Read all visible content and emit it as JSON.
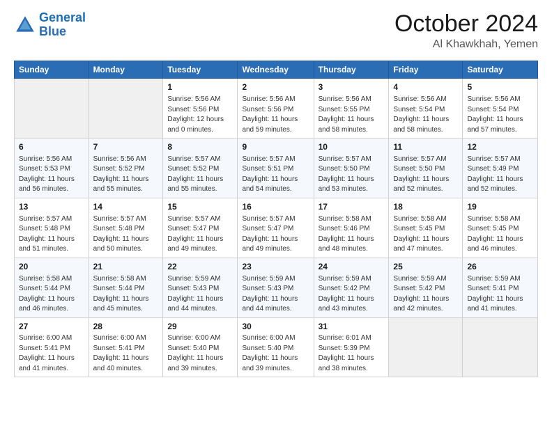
{
  "logo": {
    "line1": "General",
    "line2": "Blue"
  },
  "title": "October 2024",
  "subtitle": "Al Khawkhah, Yemen",
  "weekdays": [
    "Sunday",
    "Monday",
    "Tuesday",
    "Wednesday",
    "Thursday",
    "Friday",
    "Saturday"
  ],
  "weeks": [
    [
      {
        "day": "",
        "info": ""
      },
      {
        "day": "",
        "info": ""
      },
      {
        "day": "1",
        "info": "Sunrise: 5:56 AM\nSunset: 5:56 PM\nDaylight: 12 hours\nand 0 minutes."
      },
      {
        "day": "2",
        "info": "Sunrise: 5:56 AM\nSunset: 5:56 PM\nDaylight: 11 hours\nand 59 minutes."
      },
      {
        "day": "3",
        "info": "Sunrise: 5:56 AM\nSunset: 5:55 PM\nDaylight: 11 hours\nand 58 minutes."
      },
      {
        "day": "4",
        "info": "Sunrise: 5:56 AM\nSunset: 5:54 PM\nDaylight: 11 hours\nand 58 minutes."
      },
      {
        "day": "5",
        "info": "Sunrise: 5:56 AM\nSunset: 5:54 PM\nDaylight: 11 hours\nand 57 minutes."
      }
    ],
    [
      {
        "day": "6",
        "info": "Sunrise: 5:56 AM\nSunset: 5:53 PM\nDaylight: 11 hours\nand 56 minutes."
      },
      {
        "day": "7",
        "info": "Sunrise: 5:56 AM\nSunset: 5:52 PM\nDaylight: 11 hours\nand 55 minutes."
      },
      {
        "day": "8",
        "info": "Sunrise: 5:57 AM\nSunset: 5:52 PM\nDaylight: 11 hours\nand 55 minutes."
      },
      {
        "day": "9",
        "info": "Sunrise: 5:57 AM\nSunset: 5:51 PM\nDaylight: 11 hours\nand 54 minutes."
      },
      {
        "day": "10",
        "info": "Sunrise: 5:57 AM\nSunset: 5:50 PM\nDaylight: 11 hours\nand 53 minutes."
      },
      {
        "day": "11",
        "info": "Sunrise: 5:57 AM\nSunset: 5:50 PM\nDaylight: 11 hours\nand 52 minutes."
      },
      {
        "day": "12",
        "info": "Sunrise: 5:57 AM\nSunset: 5:49 PM\nDaylight: 11 hours\nand 52 minutes."
      }
    ],
    [
      {
        "day": "13",
        "info": "Sunrise: 5:57 AM\nSunset: 5:48 PM\nDaylight: 11 hours\nand 51 minutes."
      },
      {
        "day": "14",
        "info": "Sunrise: 5:57 AM\nSunset: 5:48 PM\nDaylight: 11 hours\nand 50 minutes."
      },
      {
        "day": "15",
        "info": "Sunrise: 5:57 AM\nSunset: 5:47 PM\nDaylight: 11 hours\nand 49 minutes."
      },
      {
        "day": "16",
        "info": "Sunrise: 5:57 AM\nSunset: 5:47 PM\nDaylight: 11 hours\nand 49 minutes."
      },
      {
        "day": "17",
        "info": "Sunrise: 5:58 AM\nSunset: 5:46 PM\nDaylight: 11 hours\nand 48 minutes."
      },
      {
        "day": "18",
        "info": "Sunrise: 5:58 AM\nSunset: 5:45 PM\nDaylight: 11 hours\nand 47 minutes."
      },
      {
        "day": "19",
        "info": "Sunrise: 5:58 AM\nSunset: 5:45 PM\nDaylight: 11 hours\nand 46 minutes."
      }
    ],
    [
      {
        "day": "20",
        "info": "Sunrise: 5:58 AM\nSunset: 5:44 PM\nDaylight: 11 hours\nand 46 minutes."
      },
      {
        "day": "21",
        "info": "Sunrise: 5:58 AM\nSunset: 5:44 PM\nDaylight: 11 hours\nand 45 minutes."
      },
      {
        "day": "22",
        "info": "Sunrise: 5:59 AM\nSunset: 5:43 PM\nDaylight: 11 hours\nand 44 minutes."
      },
      {
        "day": "23",
        "info": "Sunrise: 5:59 AM\nSunset: 5:43 PM\nDaylight: 11 hours\nand 44 minutes."
      },
      {
        "day": "24",
        "info": "Sunrise: 5:59 AM\nSunset: 5:42 PM\nDaylight: 11 hours\nand 43 minutes."
      },
      {
        "day": "25",
        "info": "Sunrise: 5:59 AM\nSunset: 5:42 PM\nDaylight: 11 hours\nand 42 minutes."
      },
      {
        "day": "26",
        "info": "Sunrise: 5:59 AM\nSunset: 5:41 PM\nDaylight: 11 hours\nand 41 minutes."
      }
    ],
    [
      {
        "day": "27",
        "info": "Sunrise: 6:00 AM\nSunset: 5:41 PM\nDaylight: 11 hours\nand 41 minutes."
      },
      {
        "day": "28",
        "info": "Sunrise: 6:00 AM\nSunset: 5:41 PM\nDaylight: 11 hours\nand 40 minutes."
      },
      {
        "day": "29",
        "info": "Sunrise: 6:00 AM\nSunset: 5:40 PM\nDaylight: 11 hours\nand 39 minutes."
      },
      {
        "day": "30",
        "info": "Sunrise: 6:00 AM\nSunset: 5:40 PM\nDaylight: 11 hours\nand 39 minutes."
      },
      {
        "day": "31",
        "info": "Sunrise: 6:01 AM\nSunset: 5:39 PM\nDaylight: 11 hours\nand 38 minutes."
      },
      {
        "day": "",
        "info": ""
      },
      {
        "day": "",
        "info": ""
      }
    ]
  ]
}
